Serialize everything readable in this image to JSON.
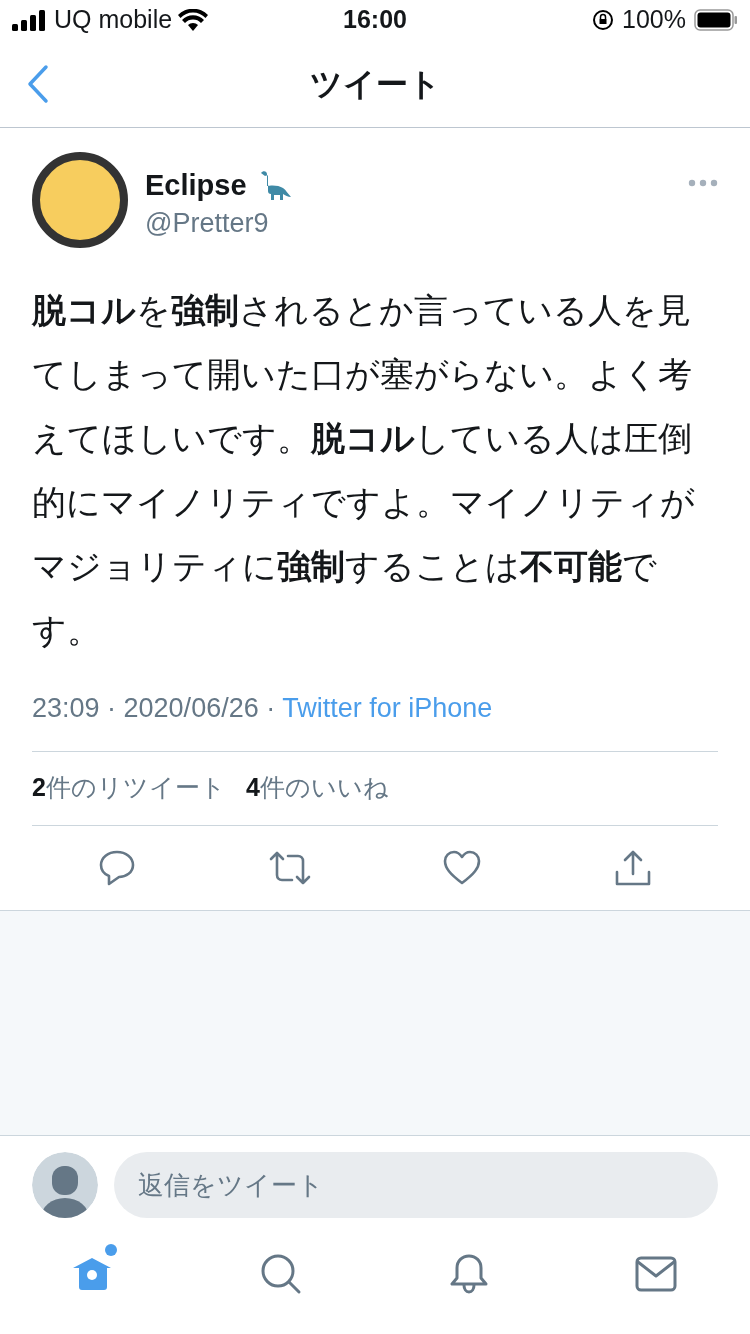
{
  "status_bar": {
    "carrier": "UQ mobile",
    "time": "16:00",
    "battery": "100%"
  },
  "nav": {
    "title": "ツイート"
  },
  "tweet": {
    "name": "Eclipse",
    "handle": "@Pretter9",
    "text": "**脱コル**を**強制**されるとか言っている人を見てしまって開いた口が塞がらない。よく考えてほしいです。**脱コル**している人は圧倒的にマイノリティですよ。マイノリティがマジョリティに**強制**することは**不可能**です。",
    "meta": "23:09 · 2020/06/26 · ",
    "source": "Twitter for iPhone",
    "stats": [
      "**2**件のリツイート",
      "**4**件のいいね"
    ]
  },
  "actions": [
    {
      "kind": "reply"
    },
    {
      "kind": "retweet"
    },
    {
      "kind": "like"
    },
    {
      "kind": "share"
    }
  ],
  "reply_box": {
    "placeholder": "返信をツイート"
  },
  "tab_bar": [
    {
      "kind": "home",
      "selected": true,
      "has_new": true
    },
    {
      "kind": "search",
      "selected": false,
      "has_new": false
    },
    {
      "kind": "notifications",
      "selected": false,
      "has_new": false
    },
    {
      "kind": "messages",
      "selected": false,
      "has_new": false
    }
  ]
}
